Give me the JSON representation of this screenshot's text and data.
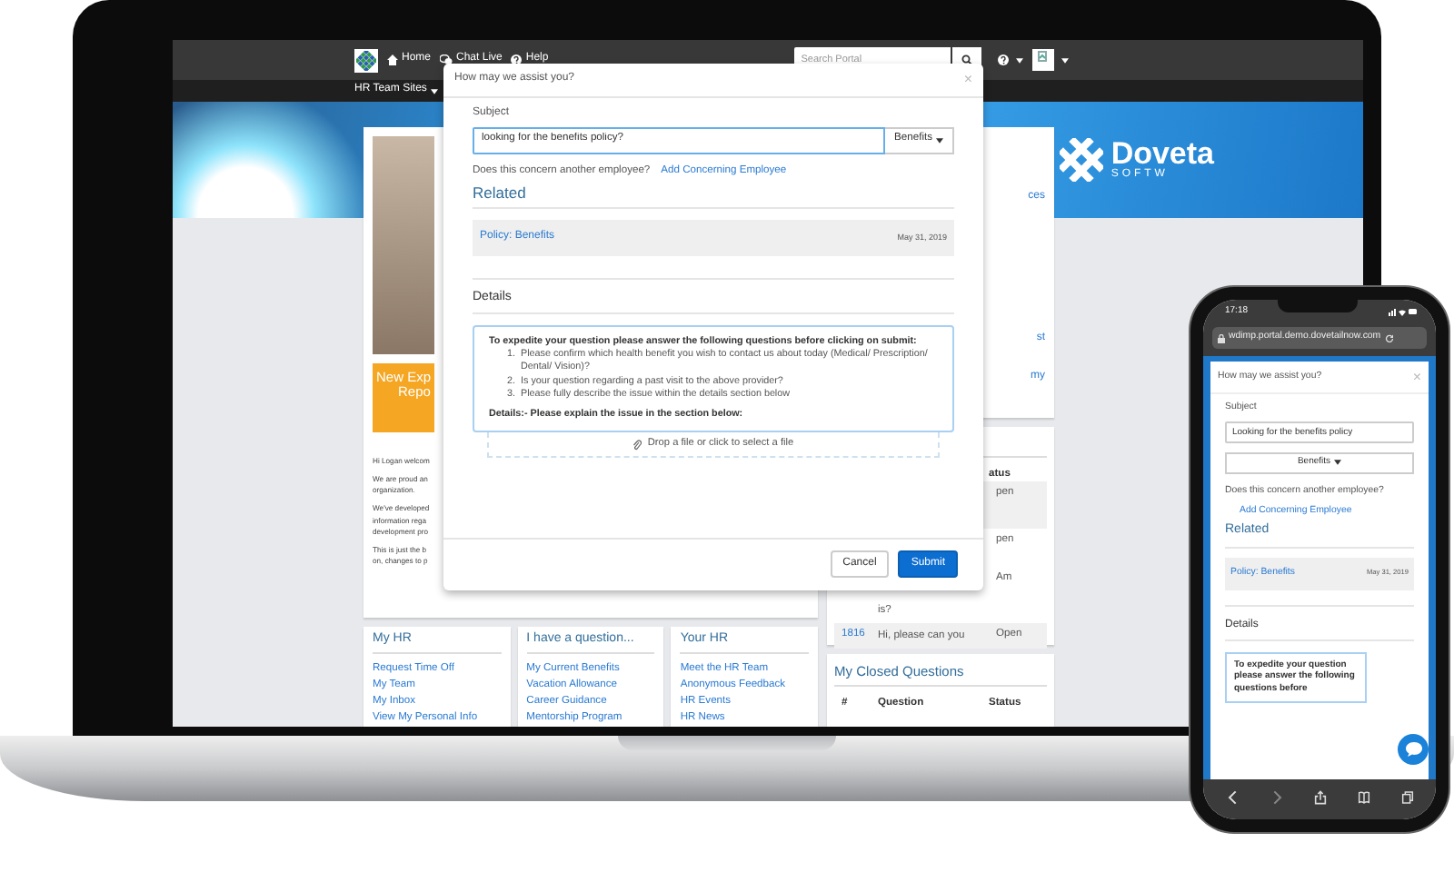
{
  "laptop": {
    "topbar": {
      "nav": [
        {
          "kind": "home",
          "label": "Home"
        },
        {
          "kind": "chat",
          "label": "Chat Live"
        },
        {
          "kind": "help",
          "label": "Help"
        }
      ],
      "search": {
        "placeholder": "Search Portal"
      }
    },
    "subbar": {
      "menu": "HR Team Sites"
    },
    "brand": {
      "name": "Doveta",
      "tagline": "SOFTW"
    },
    "intro_card": {
      "banner": [
        "New Exp",
        "Repo"
      ],
      "paragraphs": [
        [
          "Hi Logan welcom"
        ],
        [
          "We are proud an",
          "organization."
        ],
        [
          "We've developed",
          "information rega",
          "development pro"
        ],
        [
          "This is just the b",
          "on, changes to p"
        ]
      ]
    },
    "quick_links": [
      {
        "title": "My HR",
        "links": [
          "Request Time Off",
          "My Team",
          "My Inbox",
          "View My Personal Info"
        ]
      },
      {
        "title": "I have a question...",
        "links": [
          "My Current Benefits",
          "Vacation Allowance",
          "Career Guidance",
          "Mentorship Program"
        ]
      },
      {
        "title": "Your HR",
        "links": [
          "Meet the HR Team",
          "Anonymous Feedback",
          "HR Events",
          "HR News"
        ]
      }
    ],
    "links_panel": {
      "fragments": [
        "ces",
        "st",
        "my"
      ]
    },
    "open_questions": {
      "status_header": "atus",
      "rows": [
        {
          "shaded": true,
          "status": "pen"
        },
        {
          "shaded": false,
          "status": "pen",
          "note": "Am",
          "question": "is?"
        },
        {
          "shaded": true,
          "number": "1816",
          "question": "Hi, please can you",
          "status": "Open"
        }
      ]
    },
    "closed_questions": {
      "title": "My Closed Questions",
      "columns": [
        "#",
        "Question",
        "Status"
      ]
    }
  },
  "modal": {
    "title": "How may we assist you?",
    "close": "×",
    "subject_label": "Subject",
    "subject_value": "looking for the benefits policy?",
    "category": "Benefits",
    "concern_question": "Does this concern another employee?",
    "concern_link": "Add Concerning Employee",
    "related_heading": "Related",
    "related": [
      {
        "title": "Policy: Benefits",
        "date": "May 31, 2019"
      }
    ],
    "details_heading": "Details",
    "editor": {
      "intro": "To expedite your question please answer the following questions before clicking on submit:",
      "questions": [
        {
          "marker": "1.",
          "text": "Please confirm which health benefit you wish to contact us about today (Medical/ Prescription/ Dental/ Vision)?"
        },
        {
          "marker": "2.",
          "text": "Is your question regarding a past visit to the above provider?"
        },
        {
          "marker": "3.",
          "text": "Please fully describe the issue within the details section below"
        }
      ],
      "outro": "Details:- Please explain the issue in the section below:"
    },
    "dropzone": "Drop a file or click to select a file",
    "buttons": [
      {
        "label": "Cancel",
        "kind": "secondary"
      },
      {
        "label": "Submit",
        "kind": "primary"
      }
    ]
  },
  "phone": {
    "time": "17:18",
    "url": "wdimp.portal.demo.dovetailnow.com",
    "modal": {
      "title": "How may we assist you?",
      "close": "×",
      "subject_label": "Subject",
      "subject_value": "Looking for the benefits policy",
      "category": "Benefits",
      "concern_question": "Does this concern another employee?",
      "concern_link": "Add Concerning Employee",
      "related_heading": "Related",
      "related": [
        {
          "title": "Policy: Benefits",
          "date": "May 31, 2019"
        }
      ],
      "details_heading": "Details",
      "editor_text": "To expedite your question please answer the following questions before"
    }
  }
}
